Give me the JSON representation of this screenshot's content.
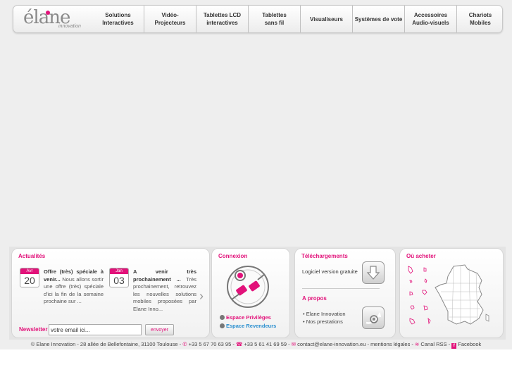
{
  "brand": {
    "name": "élane",
    "tagline": "innovation"
  },
  "nav": {
    "items": [
      {
        "label": "Solutions Interactives",
        "lines": [
          "Solutions",
          "Interactives"
        ],
        "width": 74
      },
      {
        "label": "Vidéo-Projecteurs",
        "lines": [
          "Vidéo-",
          "Projecteurs"
        ],
        "width": 74
      },
      {
        "label": "Tablettes LCD interactives",
        "lines": [
          "Tablettes LCD",
          "interactives"
        ],
        "width": 74
      },
      {
        "label": "Tablettes sans fil",
        "lines": [
          "Tablettes",
          "sans fil"
        ],
        "width": 74
      },
      {
        "label": "Visualiseurs",
        "lines": [
          "Visualiseurs"
        ],
        "width": 74
      },
      {
        "label": "Systèmes de vote",
        "lines": [
          "Systèmes de vote"
        ],
        "width": 74
      },
      {
        "label": "Accessoires Audio-visuels",
        "lines": [
          "Accessoires",
          "Audio-visuels"
        ],
        "width": 74
      },
      {
        "label": "Chariots Mobiles",
        "lines": [
          "Chariots",
          "Mobiles"
        ],
        "width": 66
      }
    ]
  },
  "news": {
    "title": "Actualités",
    "items": [
      {
        "month": "Avr",
        "day": "20",
        "title": "Offre (très) spéciale à venir...",
        "body": "Nous allons sortir une offre (très) spéciale d'ici la fin de la semaine prochaine sur ..."
      },
      {
        "month": "Jan",
        "day": "03",
        "title": "A venir très prochainement ...",
        "body": "Très prochainement, retrouvez les nouvelles solutions mobiles proposées par Elane Inno..."
      }
    ],
    "newsletter": {
      "label": "Newsletter",
      "placeholder": "votre email ici...",
      "button": "envoyer"
    }
  },
  "connexion": {
    "title": "Connexion",
    "links": [
      {
        "label": "Espace Privilèges"
      },
      {
        "label": "Espace Revendeurs"
      }
    ]
  },
  "downloads": {
    "title": "Téléchargements",
    "item": "Logiciel version gratuite",
    "about_title": "A propos",
    "about_items": [
      "Elane Innovation",
      "Nos prestations"
    ]
  },
  "buy": {
    "title": "Où acheter"
  },
  "footer": {
    "address": "© Elane Innovation - 28 allée de Bellefontaine, 31100 Toulouse -",
    "phone": "+33 5 67 70 63 95 -",
    "fax": "+33 5 61 41 69 59 -",
    "email": "contact@elane-innovation.eu -",
    "legal": "mentions légales -",
    "rss": "Canal RSS -",
    "facebook": "Facebook"
  },
  "colors": {
    "accent": "#e2127a",
    "link_blue": "#2b8fcf",
    "background": "#eeeeee"
  }
}
